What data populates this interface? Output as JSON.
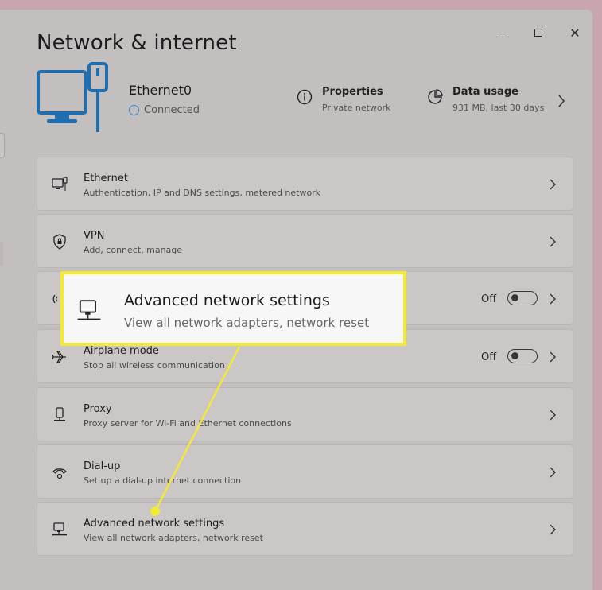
{
  "window": {
    "title": "Network & internet",
    "controls": {
      "minimize": "minimize-icon",
      "maximize": "maximize-icon",
      "close": "close-icon",
      "close_glyph": "✕"
    }
  },
  "hero": {
    "icon": "ethernet-monitor-icon",
    "adapter_name": "Ethernet0",
    "status": "Connected",
    "properties": {
      "title": "Properties",
      "subtitle": "Private network",
      "icon": "info-icon"
    },
    "data_usage": {
      "title": "Data usage",
      "subtitle": "931 MB, last 30 days",
      "icon": "pie-chart-icon"
    }
  },
  "settings": {
    "ethernet": {
      "title": "Ethernet",
      "subtitle": "Authentication, IP and DNS settings, metered network",
      "icon": "ethernet-icon"
    },
    "vpn": {
      "title": "VPN",
      "subtitle": "Add, connect, manage",
      "icon": "shield-icon"
    },
    "hotspot": {
      "toggle_label": "Off",
      "icon": "hotspot-icon"
    },
    "airplane": {
      "title": "Airplane mode",
      "subtitle": "Stop all wireless communication",
      "toggle_label": "Off",
      "icon": "airplane-icon"
    },
    "proxy": {
      "title": "Proxy",
      "subtitle": "Proxy server for Wi-Fi and Ethernet connections",
      "icon": "proxy-icon"
    },
    "dialup": {
      "title": "Dial-up",
      "subtitle": "Set up a dial-up internet connection",
      "icon": "dialup-icon"
    },
    "advanced": {
      "title": "Advanced network settings",
      "subtitle": "View all network adapters, network reset",
      "icon": "network-adapter-icon"
    }
  },
  "callout": {
    "title": "Advanced network settings",
    "subtitle": "View all network adapters, network reset",
    "highlight_color": "#f3ea35"
  },
  "colors": {
    "accent": "#1f6fb0",
    "highlight": "#f3ea35"
  }
}
